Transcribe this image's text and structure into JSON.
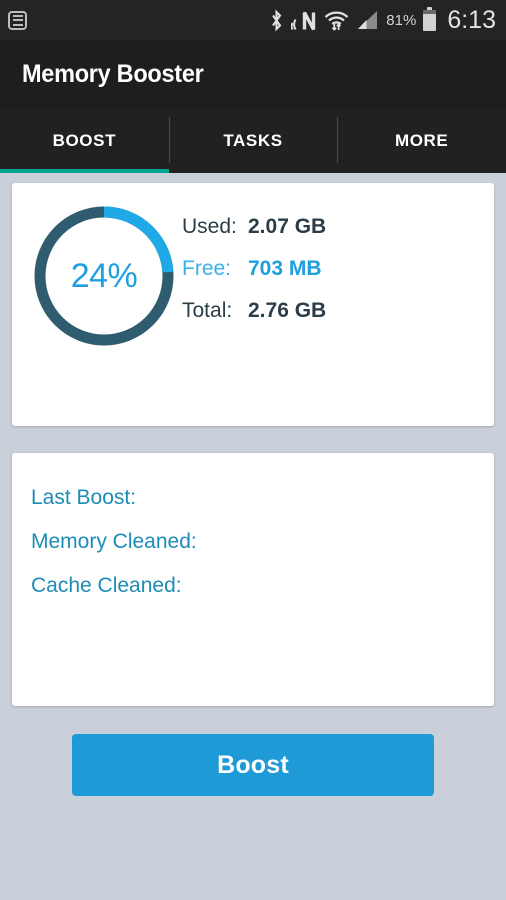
{
  "status_bar": {
    "notification_icon": "notification-list-icon",
    "icons": [
      "bluetooth-icon",
      "nfc-icon",
      "wifi-icon",
      "cellular-signal-icon"
    ],
    "battery_percent": "81%",
    "battery_level": 81,
    "battery_icon": "battery-icon",
    "time": "6:13"
  },
  "app_bar": {
    "title": "Memory Booster"
  },
  "tabs": [
    {
      "label": "BOOST",
      "active": true
    },
    {
      "label": "TASKS",
      "active": false
    },
    {
      "label": "MORE",
      "active": false
    }
  ],
  "memory_card": {
    "gauge": {
      "percent_label": "24%",
      "percent_value": 24,
      "arc_color": "#1fa9e6",
      "track_color": "#2f5c6e"
    },
    "stats": [
      {
        "key": "Used:",
        "value": "2.07 GB",
        "highlight": false
      },
      {
        "key": "Free:",
        "value": "703 MB",
        "highlight": true
      },
      {
        "key": "Total:",
        "value": "2.76 GB",
        "highlight": false
      }
    ]
  },
  "boost_info_card": {
    "rows": [
      {
        "label": "Last Boost:",
        "value": ""
      },
      {
        "label": "Memory Cleaned:",
        "value": ""
      },
      {
        "label": "Cache Cleaned:",
        "value": ""
      }
    ]
  },
  "boost_button": {
    "label": "Boost"
  },
  "colors": {
    "background": "#c9d0d9",
    "accent_blue": "#1e9ad6",
    "tab_indicator": "#00a38e",
    "app_bar": "#1e1e1e",
    "status_bar": "#242424",
    "info_text": "#1d8cb8"
  }
}
